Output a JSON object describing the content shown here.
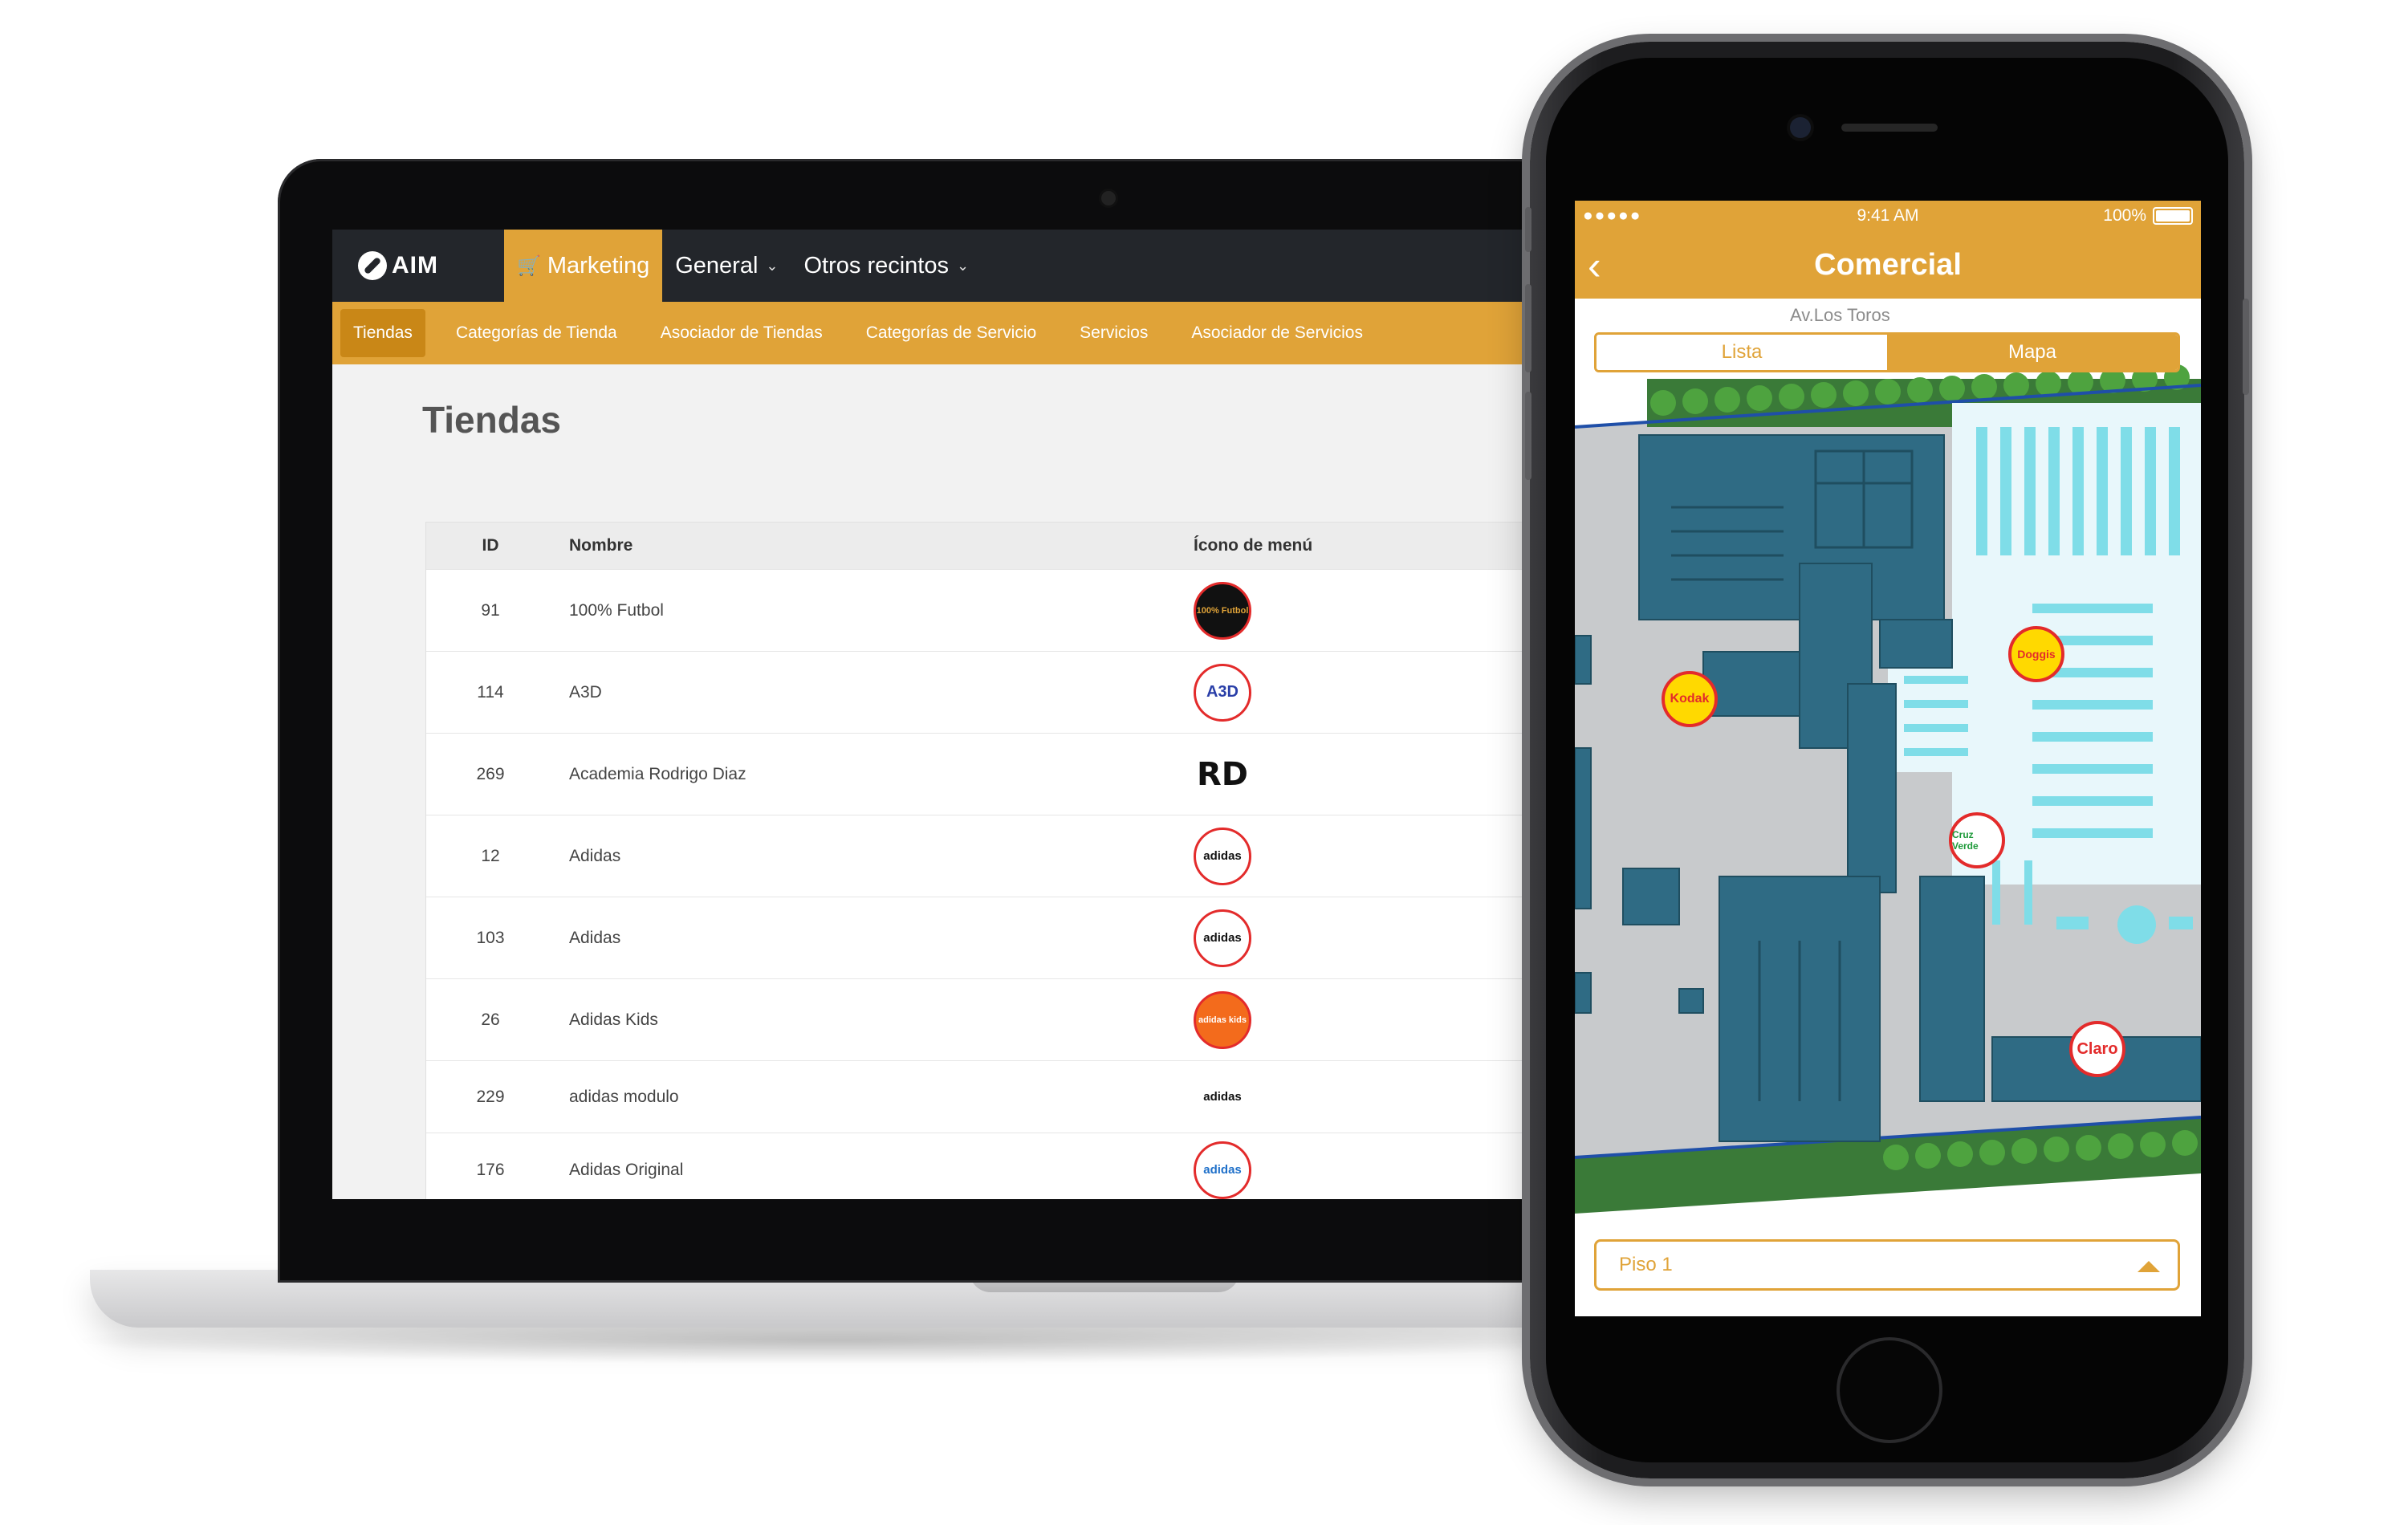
{
  "laptop": {
    "app": {
      "logo_text": "AIM"
    },
    "topnav": [
      {
        "label": "Marketing",
        "icon": "cart-icon",
        "active": true
      },
      {
        "label": "General",
        "icon": "chevron-down-icon",
        "active": false
      },
      {
        "label": "Otros recintos",
        "icon": "chevron-down-icon",
        "active": false
      }
    ],
    "subnav": [
      {
        "label": "Tiendas",
        "active": true
      },
      {
        "label": "Categorías de Tienda"
      },
      {
        "label": "Asociador de Tiendas"
      },
      {
        "label": "Categorías de Servicio"
      },
      {
        "label": "Servicios"
      },
      {
        "label": "Asociador de Servicios"
      }
    ],
    "page_title": "Tiendas",
    "table": {
      "headers": [
        "ID",
        "Nombre",
        "Ícono de menú"
      ],
      "rows": [
        {
          "id": "91",
          "name": "100% Futbol",
          "icon_text": "100% Futbol"
        },
        {
          "id": "114",
          "name": "A3D",
          "icon_text": "A3D"
        },
        {
          "id": "269",
          "name": "Academia Rodrigo Diaz",
          "icon_text": "RD"
        },
        {
          "id": "12",
          "name": "Adidas",
          "icon_text": "adidas"
        },
        {
          "id": "103",
          "name": "Adidas",
          "icon_text": "adidas"
        },
        {
          "id": "26",
          "name": "Adidas Kids",
          "icon_text": "adidas kids"
        },
        {
          "id": "229",
          "name": "adidas modulo",
          "icon_text": "adidas"
        },
        {
          "id": "176",
          "name": "Adidas Original",
          "icon_text": "adidas"
        }
      ]
    }
  },
  "phone": {
    "status": {
      "signal": "●●●●●",
      "time": "9:41 AM",
      "battery": "100%"
    },
    "title": "Comercial",
    "street": "Av.Los Toros",
    "segments": [
      "Lista",
      "Mapa"
    ],
    "pins": [
      "Kodak",
      "Doggis",
      "Cruz Verde",
      "Claro"
    ],
    "floor_select": "Piso 1"
  },
  "colors": {
    "accent": "#e0a338",
    "dark": "#23262b",
    "map_dark": "#2f6b84",
    "map_light": "#7fdde8"
  }
}
